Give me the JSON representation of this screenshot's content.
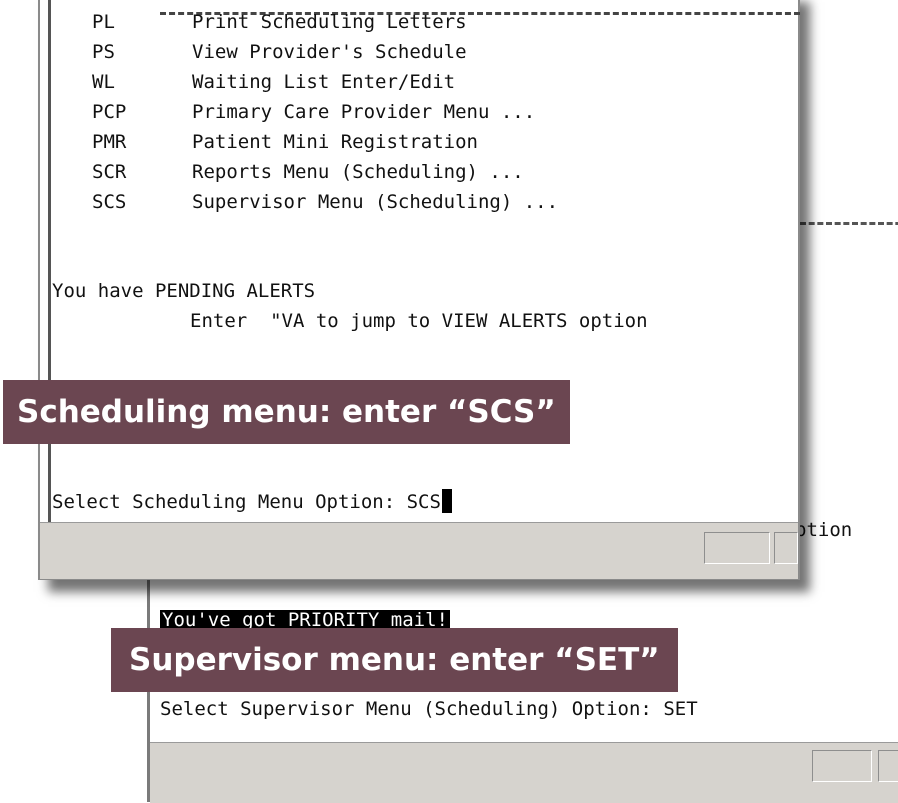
{
  "back_window": {
    "option_fragment": "ption",
    "priority_mail": "You've got PRIORITY mail!",
    "prompt": "Select Supervisor Menu (Scheduling) Option: SET"
  },
  "front_window": {
    "menu_items": [
      {
        "code": "PL",
        "label": "Print Scheduling Letters"
      },
      {
        "code": "PS",
        "label": "View Provider's Schedule"
      },
      {
        "code": "WL",
        "label": "Waiting List Enter/Edit"
      },
      {
        "code": "PCP",
        "label": "Primary Care Provider Menu ..."
      },
      {
        "code": "PMR",
        "label": "Patient Mini Registration"
      },
      {
        "code": "SCR",
        "label": "Reports Menu (Scheduling) ..."
      },
      {
        "code": "SCS",
        "label": "Supervisor Menu (Scheduling) ..."
      }
    ],
    "alerts_line": "You have PENDING ALERTS",
    "alerts_hint": "Enter  \"VA to jump to VIEW ALERTS option",
    "prompt_label": "Select Scheduling Menu Option: ",
    "prompt_value": "SCS"
  },
  "callouts": {
    "scheduling": "Scheduling menu: enter “SCS”",
    "supervisor": "Supervisor menu: enter “SET”"
  },
  "colors": {
    "callout_background": "#6b4651",
    "status_bar": "#d6d3ce",
    "terminal_background": "#ffffff"
  }
}
